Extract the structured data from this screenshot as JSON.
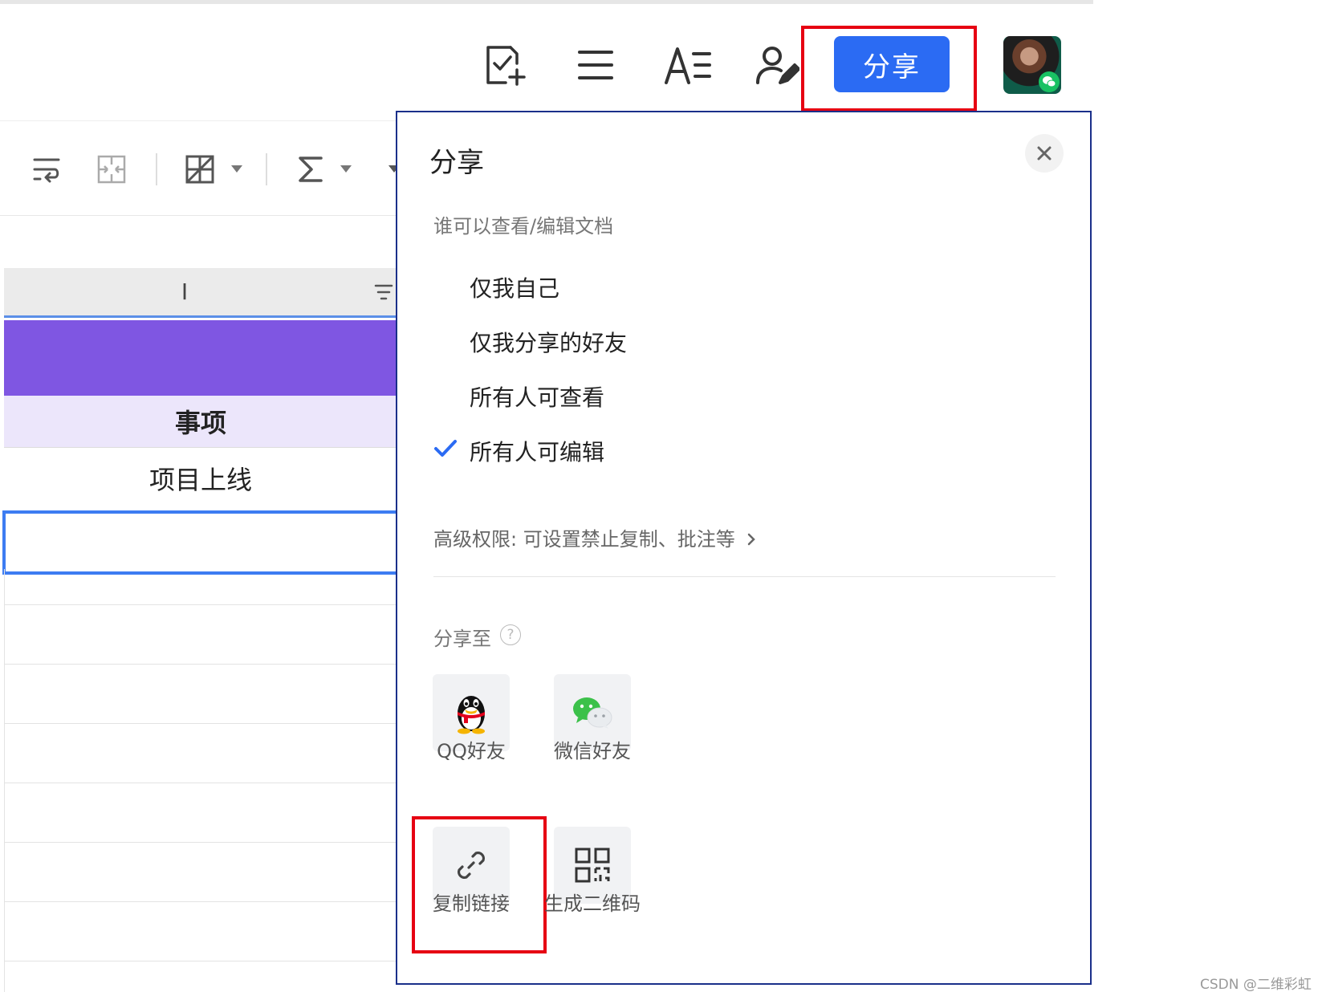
{
  "header": {
    "share_button": "分享"
  },
  "sheet": {
    "column_letter": "I",
    "header_cell": "事项",
    "first_cell": "项目上线"
  },
  "share_panel": {
    "title": "分享",
    "who_can_label": "谁可以查看/编辑文档",
    "permissions": [
      {
        "label": "仅我自己",
        "selected": false
      },
      {
        "label": "仅我分享的好友",
        "selected": false
      },
      {
        "label": "所有人可查看",
        "selected": false
      },
      {
        "label": "所有人可编辑",
        "selected": true
      }
    ],
    "advanced": "高级权限: 可设置禁止复制、批注等",
    "share_to_label": "分享至",
    "help_glyph": "?",
    "targets": [
      {
        "label": "QQ好友",
        "icon": "qq-penguin-icon"
      },
      {
        "label": "微信好友",
        "icon": "wechat-icon"
      },
      {
        "label": "复制链接",
        "icon": "link-icon"
      },
      {
        "label": "生成二维码",
        "icon": "qr-code-icon"
      }
    ]
  },
  "watermark": "CSDN @二维彩虹",
  "colors": {
    "primary_blue": "#2b6bf3",
    "highlight_red": "#e60012",
    "purple_band": "#7f56e2",
    "header_lavender": "#ece6fb",
    "panel_border": "#1a2f8a"
  }
}
